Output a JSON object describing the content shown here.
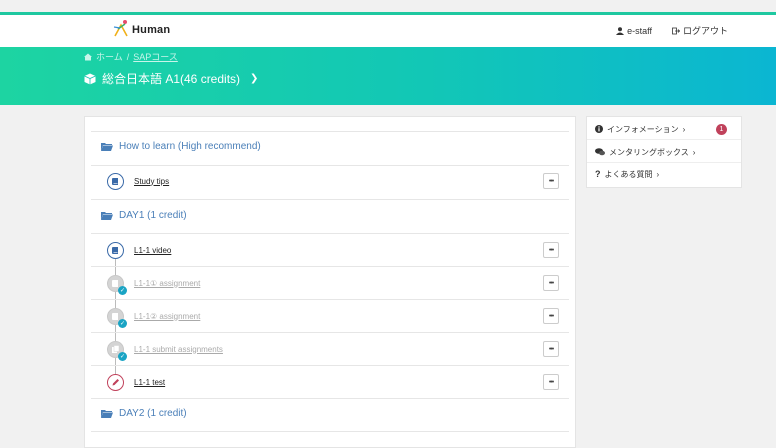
{
  "header": {
    "logo_text": "Human",
    "user_label": "e-staff",
    "logout_label": "ログアウト"
  },
  "hero": {
    "breadcrumb_home": "ホーム",
    "breadcrumb_sep": "/",
    "breadcrumb_course": "SAPコース",
    "course_title": "総合日本語 A1(46 credits)"
  },
  "sections": [
    {
      "title": "How to learn (High recommend)",
      "items": [
        {
          "label": "Study tips",
          "icon": "book-icon",
          "state": "active"
        }
      ]
    },
    {
      "title": "DAY1 (1 credit)",
      "items": [
        {
          "label": "L1-1 video",
          "icon": "book-icon",
          "state": "active"
        },
        {
          "label": "L1-1① assignment",
          "icon": "book-icon",
          "state": "done"
        },
        {
          "label": "L1-1② assignment",
          "icon": "book-icon",
          "state": "done"
        },
        {
          "label": "L1-1 submit assignments",
          "icon": "files-icon",
          "state": "done"
        },
        {
          "label": "L1-1 test",
          "icon": "pencil-icon",
          "state": "active"
        }
      ]
    },
    {
      "title": "DAY2 (1 credit)",
      "items": []
    }
  ],
  "more_label": "•••",
  "sidebar": {
    "information_label": "インフォメーション",
    "information_count": "1",
    "mentoring_label": "メンタリングボックス",
    "faq_label": "よくある質問"
  },
  "colors": {
    "accent_green": "#1dd4a2",
    "accent_blue": "#0bb6d2",
    "link_blue": "#4a7fb8",
    "badge_red": "#c0415b"
  }
}
